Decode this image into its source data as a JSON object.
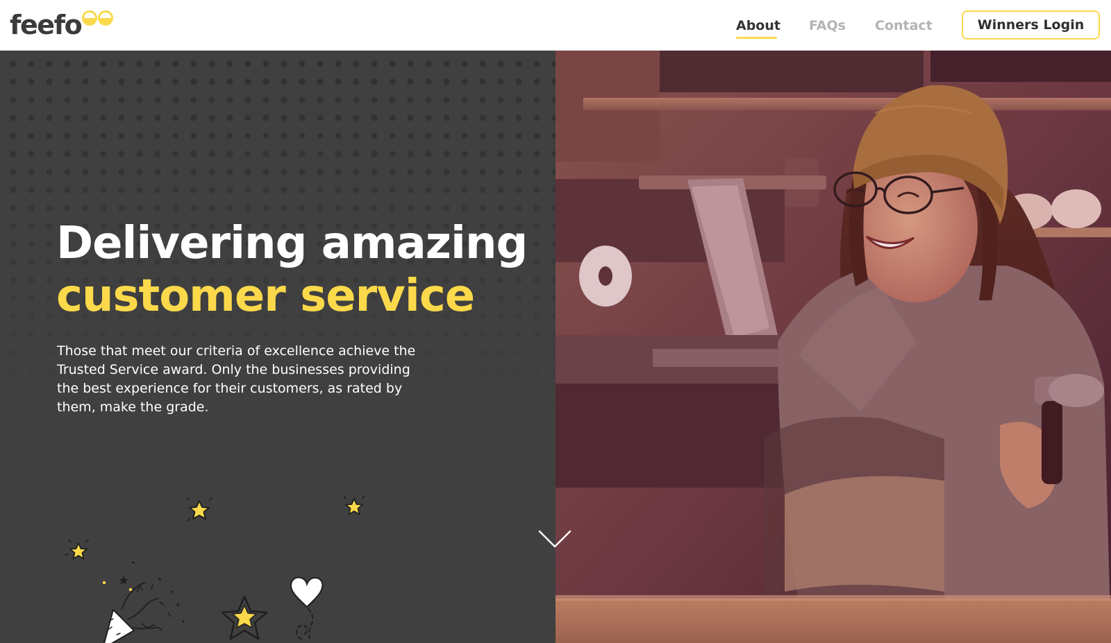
{
  "header": {
    "logo": {
      "text": "feefo",
      "icon": "feefo-eyes-icon"
    },
    "nav": [
      {
        "label": "About",
        "active": true
      },
      {
        "label": "FAQs",
        "active": false
      },
      {
        "label": "Contact",
        "active": false
      }
    ],
    "login_label": "Winners Login"
  },
  "hero": {
    "headline_line1": "Delivering amazing",
    "headline_line2": "customer service",
    "intro": "Those that meet our criteria of excellence achieve the Trusted Service award. Only the businesses providing the best experience for their customers, as rated by them, make the grade.",
    "scroll_icon": "chevron-down-icon",
    "doodle_icons": [
      "party-popper-icon",
      "star-icon",
      "heart-icon"
    ]
  },
  "colors": {
    "accent_yellow": "#fbd94a",
    "dark_panel": "#404040",
    "nav_active": "#333333",
    "nav_inactive": "#b3b3b3",
    "photo_tint": "#5a2f3a"
  }
}
